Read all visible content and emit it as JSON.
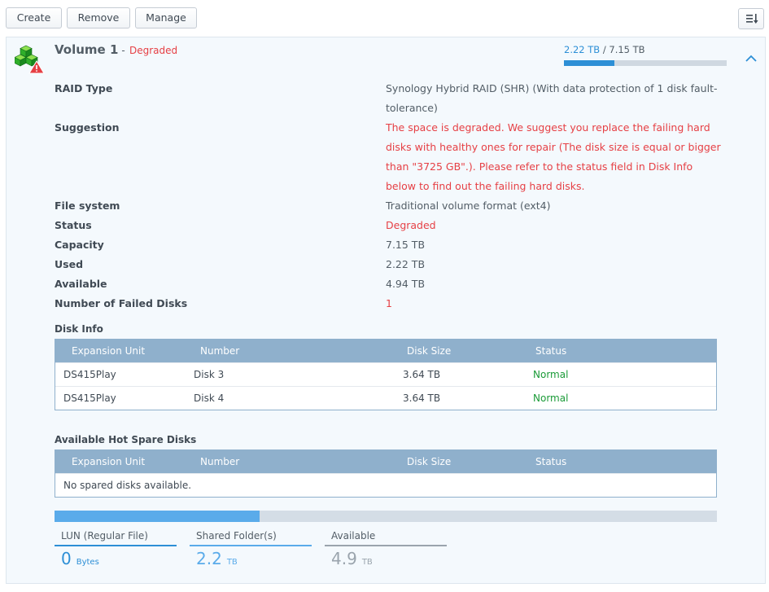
{
  "toolbar": {
    "create_label": "Create",
    "remove_label": "Remove",
    "manage_label": "Manage",
    "sort_icon": "sort-descending-icon"
  },
  "volume": {
    "name": "Volume 1",
    "separator": "-",
    "state": "Degraded",
    "usage_used": "2.22 TB",
    "usage_sep": " / ",
    "usage_total": "7.15 TB",
    "usage_fraction": 0.31,
    "icon": "volume-degraded-icon"
  },
  "properties": [
    {
      "label": "RAID Type",
      "value": "Synology Hybrid RAID (SHR) (With data protection of 1 disk fault-tolerance)",
      "style": "normal"
    },
    {
      "label": "Suggestion",
      "value": "The space is degraded. We suggest you replace the failing hard disks with healthy ones for repair (The disk size is equal or bigger than \"3725 GB\".). Please refer to the status field in Disk Info below to find out the failing hard disks.",
      "style": "red"
    },
    {
      "label": "File system",
      "value": "Traditional volume format (ext4)",
      "style": "normal"
    },
    {
      "label": "Status",
      "value": "Degraded",
      "style": "red"
    },
    {
      "label": "Capacity",
      "value": "7.15 TB",
      "style": "normal"
    },
    {
      "label": "Used",
      "value": "2.22 TB",
      "style": "normal"
    },
    {
      "label": "Available",
      "value": "4.94 TB",
      "style": "normal"
    },
    {
      "label": "Number of Failed Disks",
      "value": "1",
      "style": "red"
    }
  ],
  "disk_info": {
    "title": "Disk Info",
    "columns": [
      "Expansion Unit",
      "Number",
      "Disk Size",
      "Status"
    ],
    "rows": [
      {
        "unit": "DS415Play",
        "number": "Disk 3",
        "size": "3.64 TB",
        "status": "Normal"
      },
      {
        "unit": "DS415Play",
        "number": "Disk 4",
        "size": "3.64 TB",
        "status": "Normal"
      }
    ]
  },
  "hot_spare": {
    "title": "Available Hot Spare Disks",
    "columns": [
      "Expansion Unit",
      "Number",
      "Disk Size",
      "Status"
    ],
    "empty_text": "No spared disks available."
  },
  "capacity": {
    "used_fraction": 0.31,
    "legend": [
      {
        "label": "LUN (Regular File)",
        "value": "0",
        "unit": "Bytes",
        "color": "#2d8fd6"
      },
      {
        "label": "Shared Folder(s)",
        "value": "2.2",
        "unit": "TB",
        "color": "#5aabea"
      },
      {
        "label": "Available",
        "value": "4.9",
        "unit": "TB",
        "color": "#9aa4ad"
      }
    ]
  },
  "colors": {
    "accent": "#2d8fd6",
    "error": "#e64045",
    "ok": "#1b9b38",
    "grid_header": "#8fb0cc"
  }
}
